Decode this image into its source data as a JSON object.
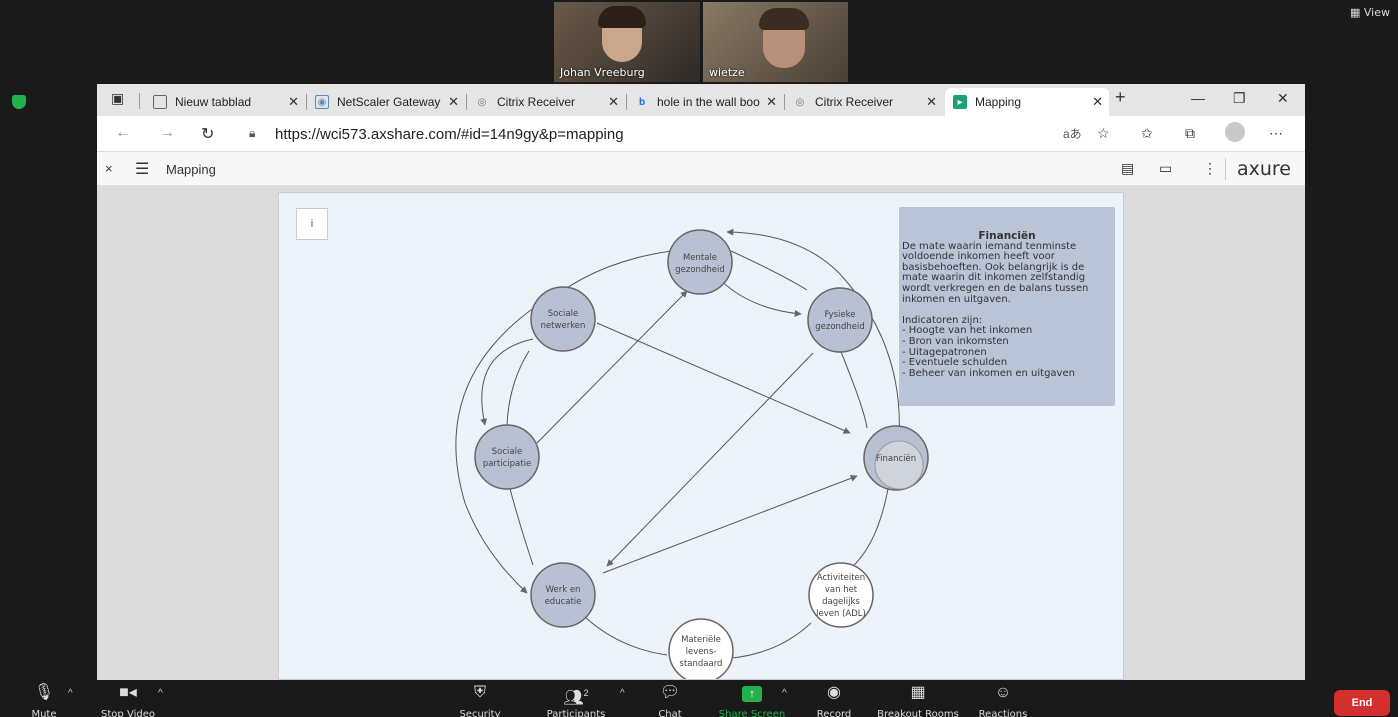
{
  "zoom": {
    "participants_video": [
      {
        "name": "Johan Vreeburg"
      },
      {
        "name": "wietze"
      }
    ],
    "view_label": "View",
    "toolbar": {
      "mute": "Mute",
      "stop_video": "Stop Video",
      "security": "Security",
      "participants": "Participants",
      "participants_count": "2",
      "chat": "Chat",
      "share_screen": "Share Screen",
      "record": "Record",
      "breakout_rooms": "Breakout Rooms",
      "reactions": "Reactions",
      "end": "End"
    }
  },
  "browser": {
    "tabs": [
      {
        "label": "Nieuw tabblad",
        "active": false
      },
      {
        "label": "NetScaler Gateway",
        "active": false
      },
      {
        "label": "Citrix Receiver",
        "active": false
      },
      {
        "label": "hole in the wall boo",
        "active": false
      },
      {
        "label": "Citrix Receiver",
        "active": false
      },
      {
        "label": "Mapping",
        "active": true
      }
    ],
    "url": "https://wci573.axshare.com/#id=14n9gy&p=mapping",
    "translate_glyph": "aあ"
  },
  "axure": {
    "page_title": "Mapping",
    "logo": "axure",
    "close_glyph": "×"
  },
  "mapping": {
    "info_button": "i",
    "panel": {
      "title": "Financiën",
      "body": "De mate waarin iemand tenminste voldoende inkomen heeft voor basisbehoeften. Ook belangrijk is de mate waarin dit inkomen zelfstandig wordt verkregen en de balans tussen inkomen en uitgaven.\n\nIndicatoren zijn:\n- Hoogte van het inkomen\n- Bron van inkomsten\n- Uitagepatronen\n- Eventuele schulden\n- Beheer van inkomen en uitgaven"
    },
    "nodes": [
      {
        "id": "mentale",
        "lines": [
          "Mentale",
          "gezondheid"
        ],
        "style": "filled"
      },
      {
        "id": "sociale-netwerken",
        "lines": [
          "Sociale",
          "netwerken"
        ],
        "style": "filled"
      },
      {
        "id": "fysieke",
        "lines": [
          "Fysieke",
          "gezondheid"
        ],
        "style": "filled"
      },
      {
        "id": "sociale-participatie",
        "lines": [
          "Sociale",
          "participatie"
        ],
        "style": "filled"
      },
      {
        "id": "financien",
        "lines": [
          "Financiën"
        ],
        "style": "selected"
      },
      {
        "id": "werk",
        "lines": [
          "Werk en",
          "educatie"
        ],
        "style": "filled"
      },
      {
        "id": "adl",
        "lines": [
          "Activiteiten",
          "van het",
          "dagelijks",
          "leven (ADL)"
        ],
        "style": "white"
      },
      {
        "id": "materiele",
        "lines": [
          "Materiële",
          "levens-",
          "standaard"
        ],
        "style": "white"
      }
    ]
  }
}
